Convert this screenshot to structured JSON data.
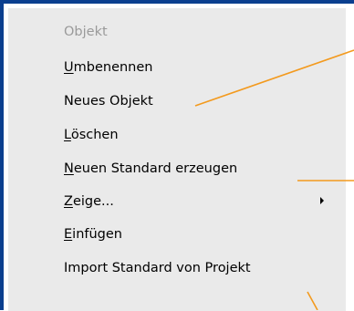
{
  "menu": {
    "header": "Objekt",
    "items": [
      {
        "prefix": "",
        "accel": "U",
        "rest": "mbenennen"
      },
      {
        "prefix": "",
        "accel": "",
        "rest": "Neues Objekt"
      },
      {
        "prefix": "",
        "accel": "L",
        "rest": "öschen"
      },
      {
        "prefix": "",
        "accel": "N",
        "rest": "euen Standard erzeugen"
      },
      {
        "prefix": "",
        "accel": "Z",
        "rest": "eige..."
      },
      {
        "prefix": "",
        "accel": "E",
        "rest": "infügen"
      },
      {
        "prefix": "",
        "accel": "",
        "rest": "Import Standard von Projekt"
      }
    ]
  },
  "colors": {
    "frame": "#0b3f8f",
    "menu_background": "#eaeaea",
    "callout_line": "#f39a1e",
    "disabled_text": "#9a9a9a"
  }
}
